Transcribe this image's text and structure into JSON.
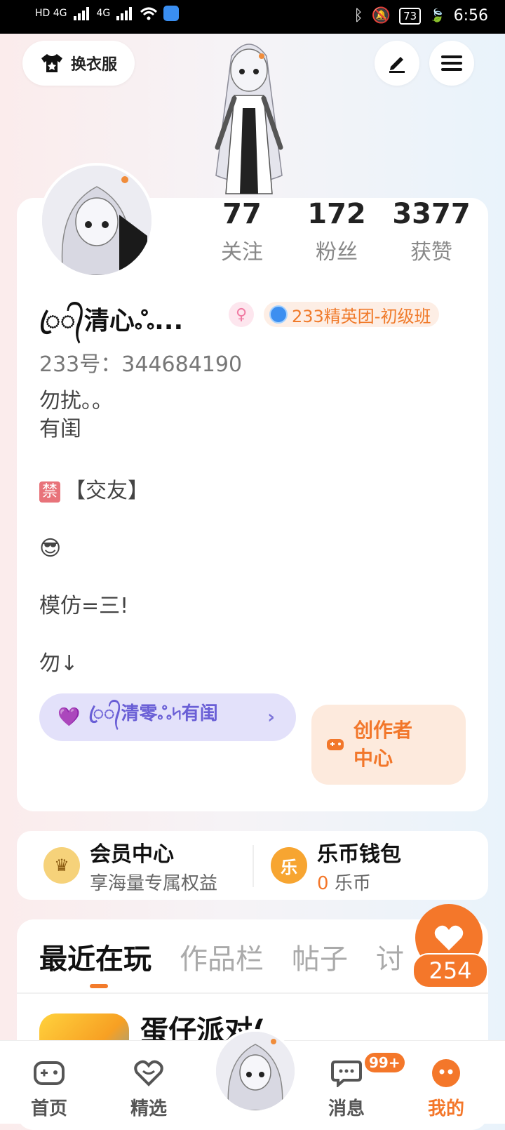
{
  "status_bar": {
    "network_left": "HD 4G",
    "network_right": "4G",
    "battery": "73",
    "time": "6:56"
  },
  "header": {
    "outfit_label": "换衣服"
  },
  "stats": [
    {
      "value": "77",
      "label": "关注"
    },
    {
      "value": "172",
      "label": "粉丝"
    },
    {
      "value": "3377",
      "label": "获赞"
    }
  ],
  "profile": {
    "name": "ꦿ᭄清心ஃ...",
    "elite_badge": "233精英团-初级班",
    "id_line": "233号：344684190",
    "bio_lines": [
      "勿扰。。",
      "有闺",
      "",
      "【交友】",
      "",
      "😎",
      "",
      "模仿=三!",
      "",
      "勿↓"
    ],
    "ban_tag": "禁",
    "group_label": "ꦿ᭄清零ஃ৸有闺",
    "creator_label": "创作者中心"
  },
  "member": {
    "vip_title": "会员中心",
    "vip_sub": "享海量专属权益",
    "wallet_title": "乐币钱包",
    "wallet_count": "0",
    "wallet_unit": "乐币",
    "coin_glyph": "乐"
  },
  "tabs": [
    "最近在玩",
    "作品栏",
    "帖子",
    "讨"
  ],
  "recent_game": {
    "title": "蛋仔派对("
  },
  "fab": {
    "count": "254"
  },
  "nav": {
    "home": "首页",
    "featured": "精选",
    "messages": "消息",
    "messages_badge": "99+",
    "mine": "我的"
  }
}
